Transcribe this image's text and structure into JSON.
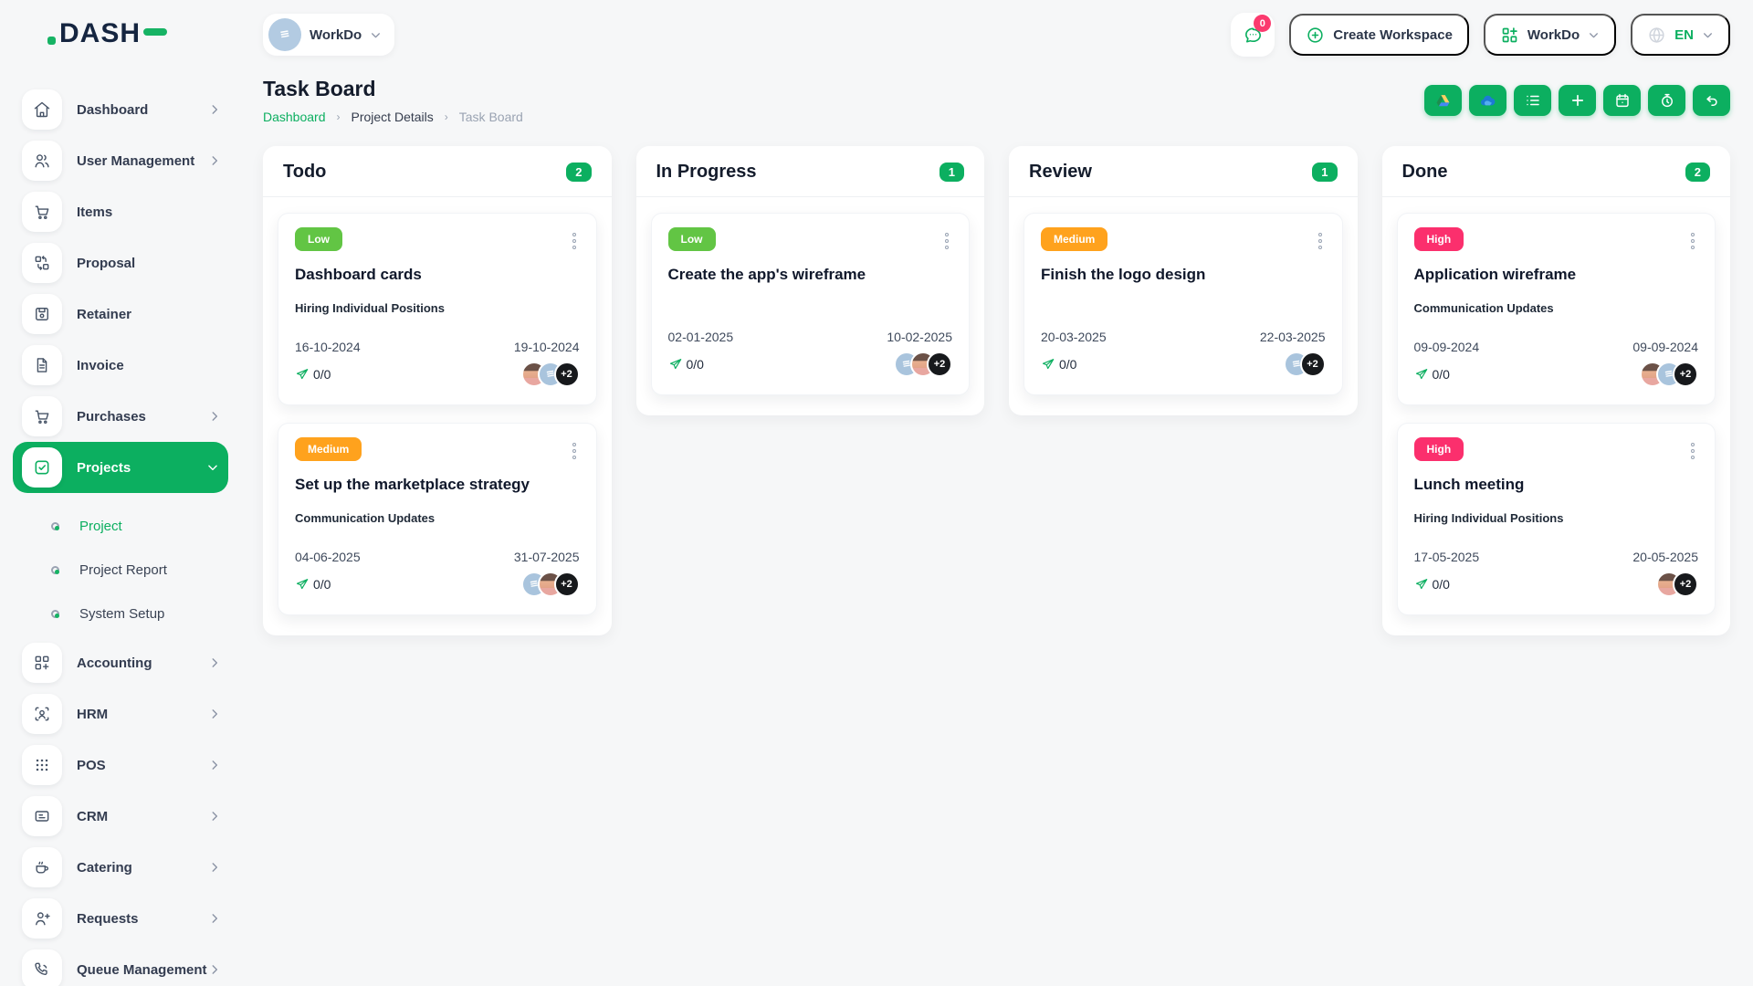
{
  "theme": {
    "primary_green": "#0CAF60",
    "priority_colors": {
      "Low": "#62C544",
      "Medium": "#FFA21D",
      "High": "#FB2F6D"
    },
    "notification_badge": "#FB3A6E",
    "workspace_avatar_blue": "#A9C4DD",
    "background": "#F6F7F8"
  },
  "logo": {
    "text": "DASH"
  },
  "header": {
    "workspace_switcher": {
      "label": "WorkDo",
      "avatar_icon": "building-icon"
    },
    "messages": {
      "badge": "0",
      "icon": "chat-bubble-icon"
    },
    "create_workspace": {
      "label": "Create Workspace",
      "icon": "plus-circle-icon"
    },
    "apps_menu": {
      "label": "WorkDo",
      "icon": "grid-plus-icon"
    },
    "language": {
      "label": "EN",
      "icon": "globe-icon"
    }
  },
  "sidebar": {
    "items": [
      {
        "label": "Dashboard",
        "icon": "home",
        "has_children": true
      },
      {
        "label": "User Management",
        "icon": "users",
        "has_children": true
      },
      {
        "label": "Items",
        "icon": "cart",
        "has_children": false
      },
      {
        "label": "Proposal",
        "icon": "proposal-blocks",
        "has_children": false
      },
      {
        "label": "Retainer",
        "icon": "floppy",
        "has_children": false
      },
      {
        "label": "Invoice",
        "icon": "file-text",
        "has_children": false
      },
      {
        "label": "Purchases",
        "icon": "cart",
        "has_children": true
      },
      {
        "label": "Projects",
        "icon": "check-square",
        "has_children": true,
        "active": true,
        "expanded": true
      },
      {
        "label": "Accounting",
        "icon": "grid-plus",
        "has_children": true
      },
      {
        "label": "HRM",
        "icon": "user-scan",
        "has_children": true
      },
      {
        "label": "POS",
        "icon": "dots-grid",
        "has_children": true
      },
      {
        "label": "CRM",
        "icon": "id-card",
        "has_children": true
      },
      {
        "label": "Catering",
        "icon": "coffee",
        "has_children": true
      },
      {
        "label": "Requests",
        "icon": "user-plus",
        "has_children": true
      },
      {
        "label": "Queue Management",
        "icon": "phone",
        "has_children": true
      }
    ],
    "projects_submenu": [
      {
        "label": "Project",
        "active": true
      },
      {
        "label": "Project Report",
        "active": false
      },
      {
        "label": "System Setup",
        "active": false
      }
    ]
  },
  "page": {
    "title": "Task Board",
    "breadcrumb": [
      "Dashboard",
      "Project Details",
      "Task Board"
    ],
    "toolbar_icons": [
      "google-drive",
      "onedrive",
      "list",
      "add",
      "calendar",
      "timer",
      "undo"
    ]
  },
  "board": {
    "columns": [
      {
        "title": "Todo",
        "count": "2",
        "cards": [
          {
            "priority": "Low",
            "title": "Dashboard cards",
            "milestone": "Hiring Individual Positions",
            "start_date": "16-10-2024",
            "end_date": "19-10-2024",
            "progress": "0/0",
            "avatars": [
              "member-photo",
              "workspace-logo"
            ],
            "overflow": "+2"
          },
          {
            "priority": "Medium",
            "title": "Set up the marketplace strategy",
            "milestone": "Communication Updates",
            "start_date": "04-06-2025",
            "end_date": "31-07-2025",
            "progress": "0/0",
            "avatars": [
              "workspace-logo",
              "member-photo"
            ],
            "overflow": "+2"
          }
        ]
      },
      {
        "title": "In Progress",
        "count": "1",
        "cards": [
          {
            "priority": "Low",
            "title": "Create the app's wireframe",
            "start_date": "02-01-2025",
            "end_date": "10-02-2025",
            "progress": "0/0",
            "avatars": [
              "workspace-logo",
              "member-photo"
            ],
            "overflow": "+2"
          }
        ]
      },
      {
        "title": "Review",
        "count": "1",
        "cards": [
          {
            "priority": "Medium",
            "title": "Finish the logo design",
            "start_date": "20-03-2025",
            "end_date": "22-03-2025",
            "progress": "0/0",
            "avatars": [
              "workspace-logo"
            ],
            "overflow": "+2"
          }
        ]
      },
      {
        "title": "Done",
        "count": "2",
        "cards": [
          {
            "priority": "High",
            "title": "Application wireframe",
            "milestone": "Communication Updates",
            "start_date": "09-09-2024",
            "end_date": "09-09-2024",
            "progress": "0/0",
            "avatars": [
              "member-photo",
              "workspace-logo"
            ],
            "overflow": "+2"
          },
          {
            "priority": "High",
            "title": "Lunch meeting",
            "milestone": "Hiring Individual Positions",
            "start_date": "17-05-2025",
            "end_date": "20-05-2025",
            "progress": "0/0",
            "avatars": [
              "member-photo"
            ],
            "overflow": "+2"
          }
        ]
      }
    ]
  }
}
